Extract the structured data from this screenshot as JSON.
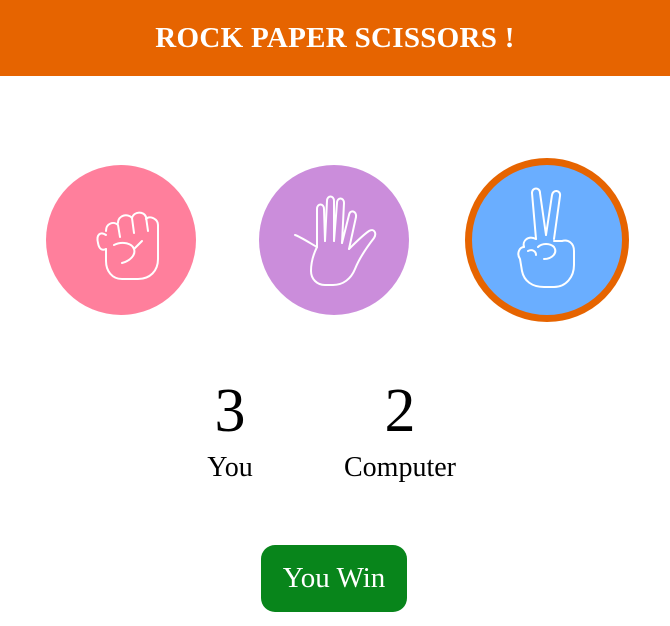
{
  "app": {
    "title": "ROCK PAPER SCISSORS !",
    "accent_color": "#e66400"
  },
  "choices": [
    {
      "id": "rock",
      "icon": "rock-fist-icon",
      "color": "#ff7f9c",
      "selected": false
    },
    {
      "id": "paper",
      "icon": "paper-open-hand-icon",
      "color": "#cb8ddb",
      "selected": false
    },
    {
      "id": "scissors",
      "icon": "scissors-peace-hand-icon",
      "color": "#6aaeff",
      "selected": true
    }
  ],
  "scores": {
    "you": {
      "value": "3",
      "label": "You"
    },
    "computer": {
      "value": "2",
      "label": "Computer"
    }
  },
  "result": {
    "text": "You Win",
    "color": "#08851b"
  }
}
